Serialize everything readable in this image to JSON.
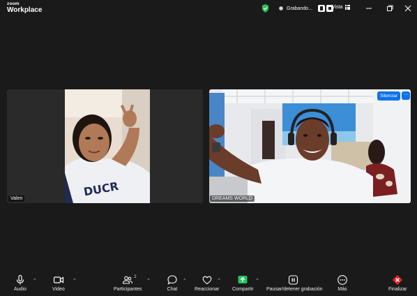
{
  "app": {
    "brand_top": "zoom",
    "brand_bottom": "Workplace"
  },
  "titlebar": {
    "recording_label": "Grabando...",
    "view_label": "Vista"
  },
  "participants": [
    {
      "name": "Valen"
    },
    {
      "name": "DREAMS WORLD",
      "mute_button": "Silenciar",
      "more_button": "···"
    }
  ],
  "toolbar": {
    "audio": "Audio",
    "video": "Video",
    "participants": "Participantes",
    "participants_count": "2",
    "chat": "Chat",
    "react": "Reaccionar",
    "share": "Compartir",
    "record": "Pausar/detener grabación",
    "more": "Más",
    "end": "Finalizar"
  },
  "colors": {
    "accent": "#0e72ed",
    "share_green": "#22c55e",
    "end_red": "#e02828",
    "shield": "#2fbf5a"
  }
}
